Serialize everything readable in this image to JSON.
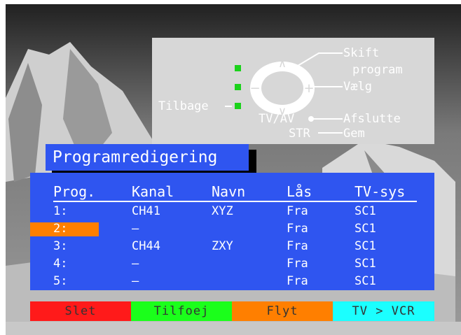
{
  "help": {
    "skift": "Skift",
    "program": "program",
    "vaelg": "Vælg",
    "tilbage": "Tilbage",
    "tvav": "TV/AV",
    "afslutte": "Afslutte",
    "str": "STR",
    "gem": "Gem"
  },
  "title": "Programredigering",
  "columns": [
    "Prog.",
    "Kanal",
    "Navn",
    "Lås",
    "TV-sys"
  ],
  "rows": [
    {
      "prog": "1:",
      "kanal": "CH41",
      "navn": "XYZ",
      "laas": "Fra",
      "tvsys": "SC1",
      "selected": false
    },
    {
      "prog": "2:",
      "kanal": "–",
      "navn": "",
      "laas": "Fra",
      "tvsys": "SC1",
      "selected": true
    },
    {
      "prog": "3:",
      "kanal": "CH44",
      "navn": "ZXY",
      "laas": "Fra",
      "tvsys": "SC1",
      "selected": false
    },
    {
      "prog": "4:",
      "kanal": "–",
      "navn": "",
      "laas": "Fra",
      "tvsys": "SC1",
      "selected": false
    },
    {
      "prog": "5:",
      "kanal": "–",
      "navn": "",
      "laas": "Fra",
      "tvsys": "SC1",
      "selected": false
    }
  ],
  "buttons": {
    "slet": "Slet",
    "tilfoej": "Tilfoej",
    "flyt": "Flyt",
    "tvvcr": "TV > VCR"
  },
  "colors": {
    "panel": "#2f55f0",
    "red": "#ff1a1a",
    "green": "#1bff1b",
    "orange": "#ff7f00",
    "cyan": "#1bffff"
  }
}
